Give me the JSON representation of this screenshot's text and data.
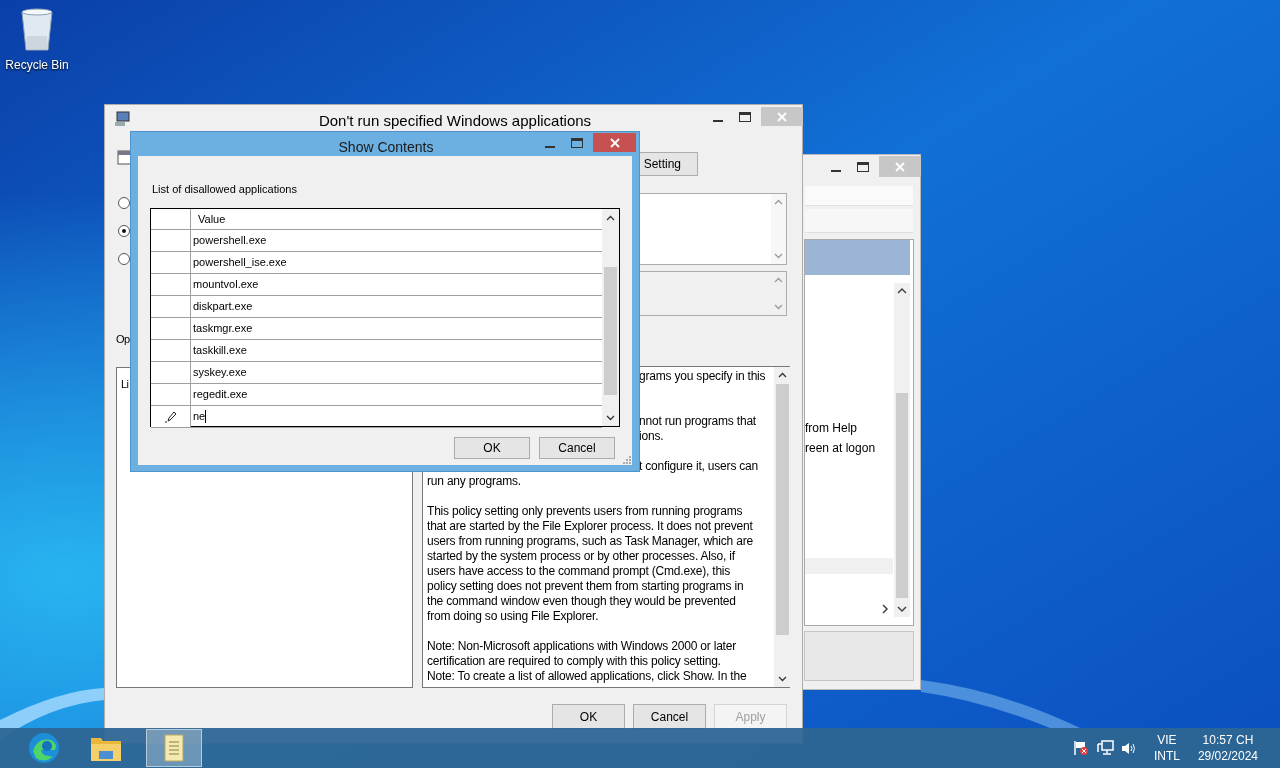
{
  "desktop": {
    "icons": [
      {
        "label": "Recycle Bin"
      }
    ]
  },
  "background_window": {
    "lines": [
      "from Help",
      "reen at logon"
    ]
  },
  "policy_dialog": {
    "title": "Don't run specified Windows applications",
    "radios": [
      {
        "selected": false
      },
      {
        "selected": true
      },
      {
        "selected": false
      }
    ],
    "setting_button": "Setting",
    "options_label": "Op",
    "options_text": "Li",
    "help_paragraphs": [
      {
        "lines": [
          {
            "text": "grams you specify in this",
            "kind": "fragment"
          }
        ]
      },
      {
        "lines": [
          {
            "text": "nnot run programs that",
            "kind": "fragment"
          },
          {
            "text": "ions.",
            "kind": "fragment"
          }
        ]
      },
      {
        "lines": [
          {
            "text": "t configure it, users can",
            "kind": "fragment"
          },
          {
            "text": "run any programs.",
            "kind": "line"
          }
        ]
      },
      {
        "lines": [
          {
            "text": "This policy setting only prevents users from running programs",
            "kind": "line"
          },
          {
            "text": "that are started by the File Explorer process. It does not prevent",
            "kind": "line"
          },
          {
            "text": "users from running programs, such as Task Manager, which are",
            "kind": "line"
          },
          {
            "text": "started by the system process or by other processes.  Also, if",
            "kind": "line"
          },
          {
            "text": "users have access to the command prompt (Cmd.exe), this",
            "kind": "line"
          },
          {
            "text": "policy setting does not prevent them from starting programs in",
            "kind": "line"
          },
          {
            "text": "the command window even though they would be prevented",
            "kind": "line"
          },
          {
            "text": "from doing so using File Explorer.",
            "kind": "line"
          }
        ]
      },
      {
        "lines": [
          {
            "text": "Note: Non-Microsoft applications with Windows 2000 or later",
            "kind": "line"
          },
          {
            "text": "certification are required to comply with this policy setting.",
            "kind": "line"
          },
          {
            "text": "Note: To create a list of allowed applications, click Show.  In the",
            "kind": "line"
          }
        ]
      }
    ],
    "buttons": [
      {
        "label": "OK",
        "disabled": false
      },
      {
        "label": "Cancel",
        "disabled": false
      },
      {
        "label": "Apply",
        "disabled": true
      }
    ]
  },
  "show_contents": {
    "title": "Show Contents",
    "label": "List of disallowed applications",
    "column": "Value",
    "rows": [
      {
        "value": "powershell.exe",
        "editing": false
      },
      {
        "value": "powershell_ise.exe",
        "editing": false
      },
      {
        "value": "mountvol.exe",
        "editing": false
      },
      {
        "value": "diskpart.exe",
        "editing": false
      },
      {
        "value": "taskmgr.exe",
        "editing": false
      },
      {
        "value": "taskkill.exe",
        "editing": false
      },
      {
        "value": "syskey.exe",
        "editing": false
      },
      {
        "value": "regedit.exe",
        "editing": false
      },
      {
        "value": "ne",
        "editing": true
      }
    ],
    "buttons": [
      "OK",
      "Cancel"
    ]
  },
  "taskbar": {
    "apps": [
      {
        "kind": "browser",
        "selected": false
      },
      {
        "kind": "folder",
        "selected": false
      },
      {
        "kind": "notepad",
        "selected": true
      }
    ],
    "language": [
      "VIE",
      "INTL"
    ],
    "time": "10:57 CH",
    "date": "29/02/2024"
  }
}
